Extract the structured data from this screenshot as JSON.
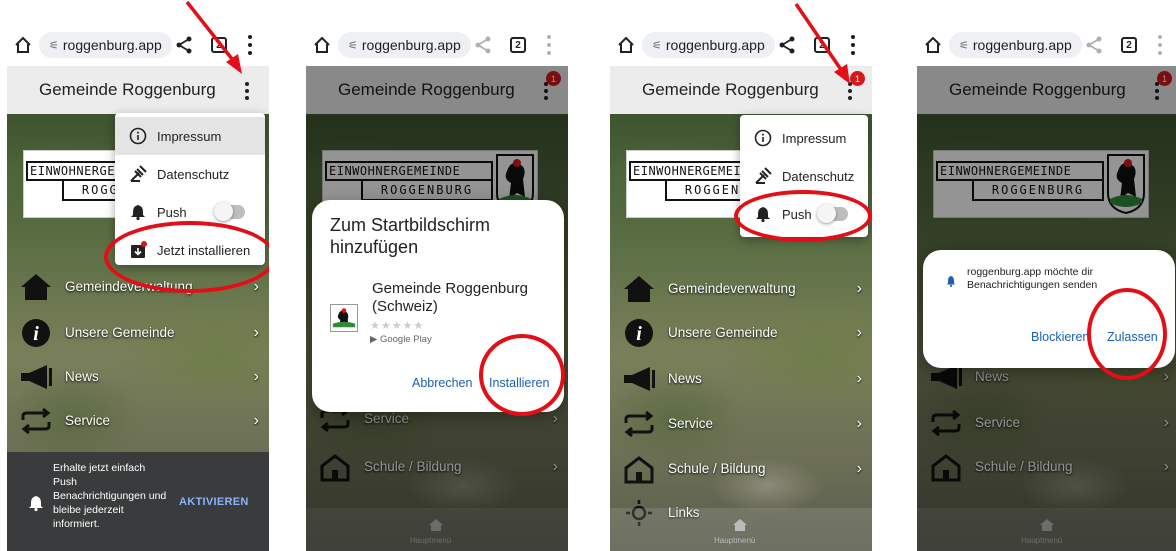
{
  "browser": {
    "url": "roggenburg.app",
    "tabs": "2"
  },
  "app": {
    "title": "Gemeinde Roggenburg",
    "badge": "1"
  },
  "logo": {
    "line1": "EINWOHNERGEMEINDE",
    "line2": "ROGGENBURG"
  },
  "nav_items": [
    {
      "label": "Gemeindeverwaltung"
    },
    {
      "label": "Unsere Gemeinde"
    },
    {
      "label": "News"
    },
    {
      "label": "Service"
    },
    {
      "label": "Schule / Bildung"
    },
    {
      "label": "Links"
    }
  ],
  "dropdown": {
    "impressum": "Impressum",
    "datenschutz": "Datenschutz",
    "push": "Push",
    "install": "Jetzt installieren"
  },
  "snackbar": {
    "text": "Erhalte jetzt einfach Push Benachrichtigungen und bleibe jederzeit informiert.",
    "action": "AKTIVIEREN"
  },
  "install_dialog": {
    "title": "Zum Startbildschirm hinzufügen",
    "app_name": "Gemeinde Roggenburg (Schweiz)",
    "stars": "★★★★★",
    "store": "Google Play",
    "cancel": "Abbrechen",
    "confirm": "Installieren"
  },
  "permission_dialog": {
    "text": "roggenburg.app möchte dir Benachrichtigungen senden",
    "block": "Blockieren",
    "allow": "Zulassen"
  },
  "bottom_nav": {
    "home": "Hauptmenü"
  },
  "colors": {
    "annotation": "#e30e16",
    "link": "#1a5fb4",
    "snack_action": "#8ab4f8"
  }
}
